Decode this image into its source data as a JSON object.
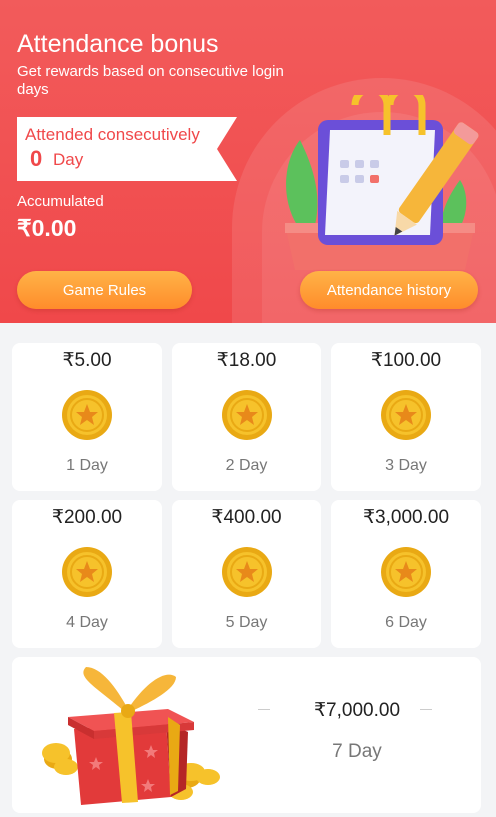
{
  "header": {
    "title": "Attendance bonus",
    "subtitle": "Get rewards based on consecutive login days",
    "attended_label": "Attended consecutively",
    "attended_count": "0",
    "attended_unit": "Day",
    "accumulated_label": "Accumulated",
    "accumulated_value": "₹0.00",
    "game_rules_label": "Game Rules",
    "history_label": "Attendance history"
  },
  "days": [
    {
      "amount": "₹5.00",
      "day": "1 Day"
    },
    {
      "amount": "₹18.00",
      "day": "2 Day"
    },
    {
      "amount": "₹100.00",
      "day": "3 Day"
    },
    {
      "amount": "₹200.00",
      "day": "4 Day"
    },
    {
      "amount": "₹400.00",
      "day": "5 Day"
    },
    {
      "amount": "₹3,000.00",
      "day": "6 Day"
    }
  ],
  "bonus_day": {
    "amount": "₹7,000.00",
    "day": "7 Day"
  },
  "colors": {
    "banner": "#f0484a",
    "button": "#ff9a33",
    "coin": "#f6c22b"
  },
  "icons": [
    "calendar-pencil-icon",
    "star-coin-icon",
    "gift-box-icon"
  ]
}
